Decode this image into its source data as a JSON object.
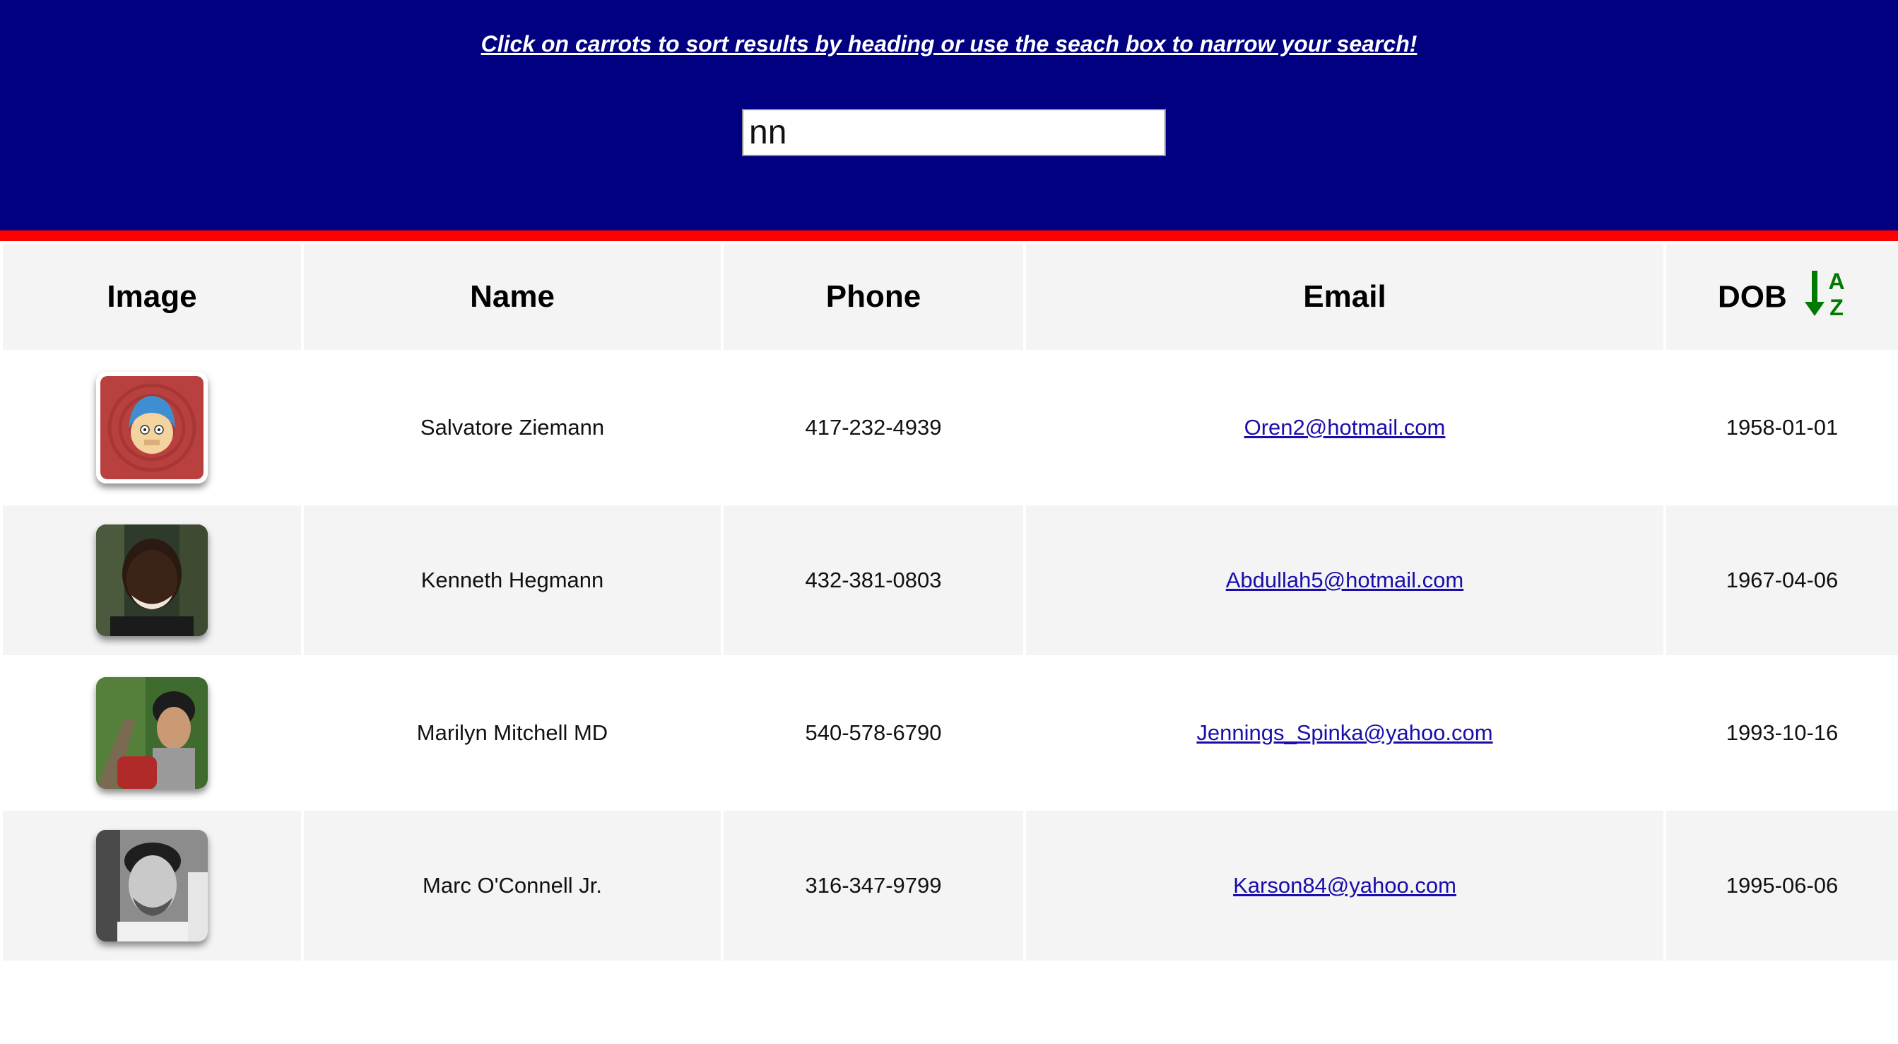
{
  "header": {
    "instructions": "Click on carrots to sort results by heading or use the seach box to narrow your search!"
  },
  "search": {
    "value": "nn"
  },
  "table": {
    "columns": {
      "image": "Image",
      "name": "Name",
      "phone": "Phone",
      "email": "Email",
      "dob": "DOB"
    },
    "sort_indicator": {
      "column": "DOB",
      "icon": "sort-alpha-down-icon",
      "top_letter": "A",
      "bottom_letter": "Z",
      "color": "#007a00"
    },
    "rows": [
      {
        "name": "Salvatore Ziemann",
        "phone": "417-232-4939",
        "email": "Oren2@hotmail.com",
        "dob": "1958-01-01",
        "avatar": "cartoon-avatar"
      },
      {
        "name": "Kenneth Hegmann",
        "phone": "432-381-0803",
        "email": "Abdullah5@hotmail.com",
        "dob": "1967-04-06",
        "avatar": "photo-avatar"
      },
      {
        "name": "Marilyn Mitchell MD",
        "phone": "540-578-6790",
        "email": "Jennings_Spinka@yahoo.com",
        "dob": "1993-10-16",
        "avatar": "photo-avatar"
      },
      {
        "name": "Marc O'Connell Jr.",
        "phone": "316-347-9799",
        "email": "Karson84@yahoo.com",
        "dob": "1995-06-06",
        "avatar": "photo-avatar"
      }
    ]
  },
  "colors": {
    "header_bg": "#000080",
    "header_border": "#ff0000",
    "row_alt": "#f4f4f4",
    "link": "#1a0dab"
  }
}
